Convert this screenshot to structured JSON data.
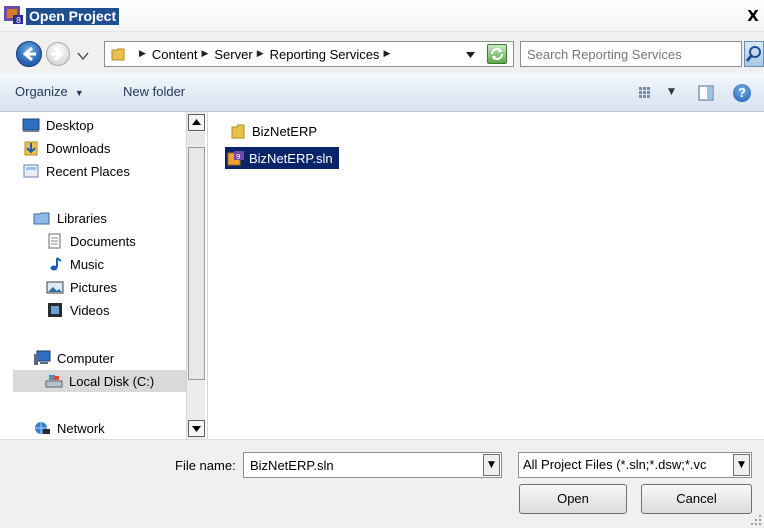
{
  "window": {
    "title": "Open Project",
    "close_glyph": "X"
  },
  "address": {
    "breadcrumbs": [
      "Content",
      "Server",
      "Reporting Services"
    ],
    "search_placeholder": "Search Reporting Services"
  },
  "toolbar": {
    "organize_label": "Organize",
    "new_folder_label": "New folder",
    "help_glyph": "?"
  },
  "sidebar": {
    "items": [
      {
        "label": "Desktop",
        "icon": "desktop-icon"
      },
      {
        "label": "Downloads",
        "icon": "downloads-icon"
      },
      {
        "label": "Recent Places",
        "icon": "recent-places-icon"
      },
      {
        "label": "Libraries",
        "icon": "libraries-icon"
      },
      {
        "label": "Documents",
        "icon": "documents-icon"
      },
      {
        "label": "Music",
        "icon": "music-icon"
      },
      {
        "label": "Pictures",
        "icon": "pictures-icon"
      },
      {
        "label": "Videos",
        "icon": "videos-icon"
      },
      {
        "label": "Computer",
        "icon": "computer-icon"
      },
      {
        "label": "Local Disk (C:)",
        "icon": "local-disk-icon",
        "selected": true
      },
      {
        "label": "Network",
        "icon": "network-icon"
      }
    ]
  },
  "files": [
    {
      "name": "BizNetERP",
      "type": "folder",
      "icon": "folder-icon"
    },
    {
      "name": "BizNetERP.sln",
      "type": "solution",
      "icon": "solution-file-icon",
      "selected": true
    }
  ],
  "footer": {
    "file_name_label": "File name:",
    "file_name_value": "BizNetERP.sln",
    "file_type_value": "All Project Files (*.sln;*.dsw;*.vc",
    "open_label": "Open",
    "cancel_label": "Cancel"
  },
  "colors": {
    "selection": "#0a246a",
    "toolbar_text": "#1e395b",
    "title_highlight": "#1f4f91"
  }
}
